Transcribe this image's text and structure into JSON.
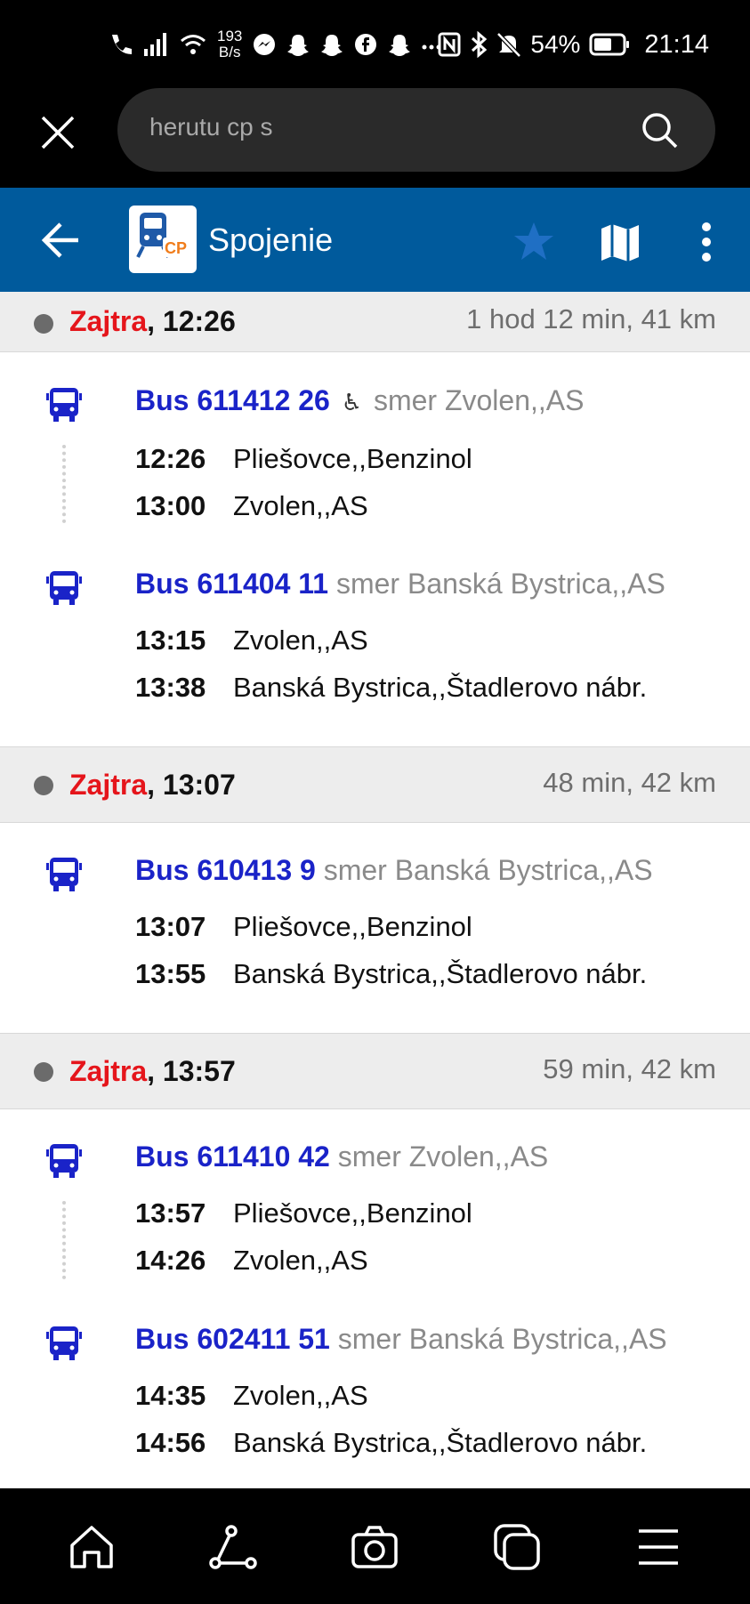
{
  "status_bar": {
    "net_speed_value": "193",
    "net_speed_unit": "B/s",
    "battery": "54%",
    "time": "21:14"
  },
  "browser": {
    "search_value": "herutu cp s"
  },
  "app_bar": {
    "logo_text": "CP",
    "title": "Spojenie"
  },
  "colors": {
    "app_bar": "#005a9c",
    "accent_day": "#e5151b",
    "bus_line": "#1a23c8",
    "star": "#1f6fc4"
  },
  "connections": [
    {
      "day": "Zajtra",
      "time": ", 12:26",
      "duration": "1 hod 12 min, 41 km",
      "legs": [
        {
          "line": "Bus 611412 26",
          "wheelchair": true,
          "direction": "smer Zvolen,,AS",
          "stops": [
            {
              "time": "12:26",
              "name": "Pliešovce,,Benzinol"
            },
            {
              "time": "13:00",
              "name": "Zvolen,,AS"
            }
          ]
        },
        {
          "line": "Bus 611404 11",
          "wheelchair": false,
          "direction": "smer Banská Bystrica,,AS",
          "stops": [
            {
              "time": "13:15",
              "name": "Zvolen,,AS"
            },
            {
              "time": "13:38",
              "name": "Banská Bystrica,,Štadlerovo nábr."
            }
          ]
        }
      ]
    },
    {
      "day": "Zajtra",
      "time": ", 13:07",
      "duration": "48 min, 42 km",
      "legs": [
        {
          "line": "Bus 610413 9",
          "wheelchair": false,
          "direction": "smer Banská Bystrica,,AS",
          "stops": [
            {
              "time": "13:07",
              "name": "Pliešovce,,Benzinol"
            },
            {
              "time": "13:55",
              "name": "Banská Bystrica,,Štadlerovo nábr."
            }
          ]
        }
      ]
    },
    {
      "day": "Zajtra",
      "time": ", 13:57",
      "duration": "59 min, 42 km",
      "legs": [
        {
          "line": "Bus 611410 42",
          "wheelchair": false,
          "direction": "smer Zvolen,,AS",
          "stops": [
            {
              "time": "13:57",
              "name": "Pliešovce,,Benzinol"
            },
            {
              "time": "14:26",
              "name": "Zvolen,,AS"
            }
          ]
        },
        {
          "line": "Bus 602411 51",
          "wheelchair": false,
          "direction": "smer Banská Bystrica,,AS",
          "stops": [
            {
              "time": "14:35",
              "name": "Zvolen,,AS"
            },
            {
              "time": "14:56",
              "name": "Banská Bystrica,,Štadlerovo nábr."
            }
          ]
        }
      ]
    }
  ],
  "icons": {
    "status": [
      "wifi-calling-icon",
      "signal-icon",
      "wifi-icon",
      "messenger-icon",
      "snapchat-icon",
      "snapchat-icon",
      "facebook-icon",
      "snapchat-icon",
      "more-notifications-icon",
      "nfc-icon",
      "bluetooth-icon",
      "mute-icon",
      "battery-icon"
    ],
    "nav": [
      "home-icon",
      "route-icon",
      "camera-icon",
      "tabs-icon",
      "menu-icon"
    ]
  }
}
